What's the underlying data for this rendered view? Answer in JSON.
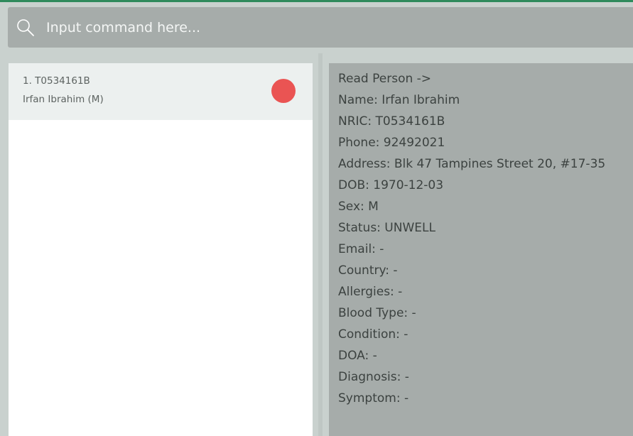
{
  "command_bar": {
    "placeholder": "Input command here...",
    "icon": "search-icon"
  },
  "person_list": {
    "items": [
      {
        "index_id": "1.  T0534161B",
        "name_sex": "Irfan Ibrahim (M)",
        "status_color": "#ea5453"
      }
    ]
  },
  "details": {
    "lines": [
      "Read Person ->",
      "Name: Irfan Ibrahim",
      "NRIC: T0534161B",
      "Phone: 92492021",
      "Address: Blk 47 Tampines Street 20, #17-35",
      "DOB: 1970-12-03",
      "Sex: M",
      "Status: UNWELL",
      "Email: -",
      "Country: -",
      "Allergies: -",
      "Blood Type: -",
      "Condition: -",
      "DOA: -",
      "Diagnosis: -",
      "Symptom: -"
    ]
  },
  "colors": {
    "accent_border": "#2f8a5c",
    "status_unwell": "#ea5453",
    "panel_gray": "#a6acaa"
  }
}
